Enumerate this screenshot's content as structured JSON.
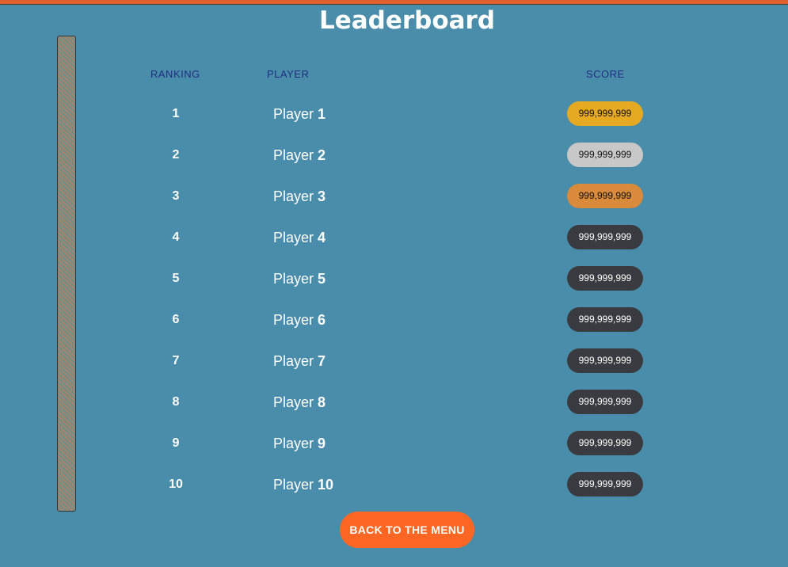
{
  "header": {
    "title": "Leaderboard"
  },
  "columns": {
    "ranking": "RANKING",
    "player": "PLAYER",
    "score": "SCORE"
  },
  "rows": [
    {
      "rank": "1",
      "player_word": "Player",
      "player_num": "1",
      "score": "999,999,999",
      "badge_color": "#e6aa22",
      "badge_text_color": "#111111"
    },
    {
      "rank": "2",
      "player_word": "Player",
      "player_num": "2",
      "score": "999,999,999",
      "badge_color": "#c8c8c8",
      "badge_text_color": "#111111"
    },
    {
      "rank": "3",
      "player_word": "Player",
      "player_num": "3",
      "score": "999,999,999",
      "badge_color": "#d98a3a",
      "badge_text_color": "#111111"
    },
    {
      "rank": "4",
      "player_word": "Player",
      "player_num": "4",
      "score": "999,999,999",
      "badge_color": "#3a3b40",
      "badge_text_color": "#ffffff"
    },
    {
      "rank": "5",
      "player_word": "Player",
      "player_num": "5",
      "score": "999,999,999",
      "badge_color": "#3a3b40",
      "badge_text_color": "#ffffff"
    },
    {
      "rank": "6",
      "player_word": "Player",
      "player_num": "6",
      "score": "999,999,999",
      "badge_color": "#3a3b40",
      "badge_text_color": "#ffffff"
    },
    {
      "rank": "7",
      "player_word": "Player",
      "player_num": "7",
      "score": "999,999,999",
      "badge_color": "#3a3b40",
      "badge_text_color": "#ffffff"
    },
    {
      "rank": "8",
      "player_word": "Player",
      "player_num": "8",
      "score": "999,999,999",
      "badge_color": "#3a3b40",
      "badge_text_color": "#ffffff"
    },
    {
      "rank": "9",
      "player_word": "Player",
      "player_num": "9",
      "score": "999,999,999",
      "badge_color": "#3a3b40",
      "badge_text_color": "#ffffff"
    },
    {
      "rank": "10",
      "player_word": "Player",
      "player_num": "10",
      "score": "999,999,999",
      "badge_color": "#3a3b40",
      "badge_text_color": "#ffffff"
    }
  ],
  "footer": {
    "back_label": "BACK TO THE MENU"
  },
  "colors": {
    "background": "#498dab",
    "accent": "#fd6723",
    "header_text": "#1f2f7e"
  }
}
